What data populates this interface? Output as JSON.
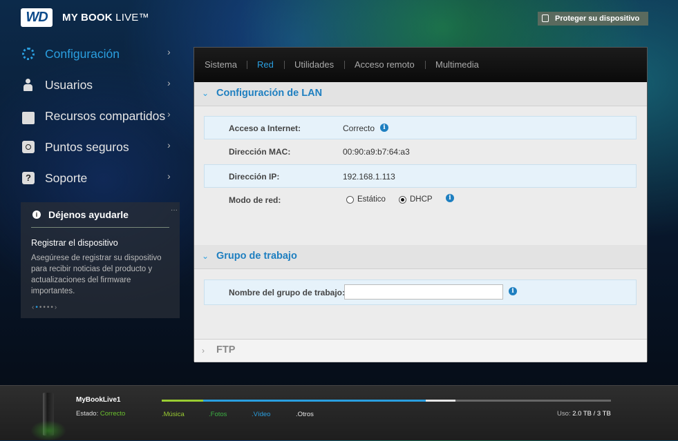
{
  "header": {
    "logo_text": "WD",
    "product_name": "MY BOOK",
    "product_suffix": " LIVE™",
    "protect_button": "Proteger su dispositivo"
  },
  "sidebar": {
    "items": [
      {
        "label": "Configuración",
        "icon": "gear-icon",
        "active": true
      },
      {
        "label": "Usuarios",
        "icon": "user-icon"
      },
      {
        "label": "Recursos compartidos",
        "icon": "folder-icon"
      },
      {
        "label": "Puntos seguros",
        "icon": "safepoint-icon"
      },
      {
        "label": "Soporte",
        "icon": "help-icon"
      }
    ]
  },
  "help_box": {
    "title": "Déjenos ayudarle",
    "subtitle": "Registrar el dispositivo",
    "text": "Asegúrese de registrar su dispositivo para recibir noticias del producto y actualizaciones del firmware importantes."
  },
  "tabs": [
    {
      "label": "Sistema"
    },
    {
      "label": "Red",
      "active": true
    },
    {
      "label": "Utilidades"
    },
    {
      "label": "Acceso remoto"
    },
    {
      "label": "Multimedia"
    }
  ],
  "lan": {
    "title": "Configuración de LAN",
    "internet_label": "Acceso a Internet:",
    "internet_value": "Correcto",
    "mac_label": "Dirección MAC:",
    "mac_value": "00:90:a9:b7:64:a3",
    "ip_label": "Dirección IP:",
    "ip_value": "192.168.1.113",
    "mode_label": "Modo de red:",
    "mode_static": "Estático",
    "mode_dhcp": "DHCP",
    "mode_selected": "DHCP"
  },
  "workgroup": {
    "title": "Grupo de trabajo",
    "name_label": "Nombre del grupo de trabajo:",
    "name_value": ""
  },
  "ftp": {
    "title": "FTP"
  },
  "footer": {
    "device_name": "MyBookLive1",
    "status_label": "Estado:",
    "status_value": "Correcto",
    "legend": [
      ".Música",
      ".Fotos",
      ".Vídeo",
      ".Otros"
    ],
    "usage_label": "Uso:",
    "usage_value": "2.0 TB / 3 TB",
    "colors": {
      "music": "#9acd32",
      "photos": "#3cb043",
      "video": "#1e90ff",
      "other": "#e6e6e6",
      "free": "#666666",
      "accent": "#2a9fe0"
    }
  }
}
